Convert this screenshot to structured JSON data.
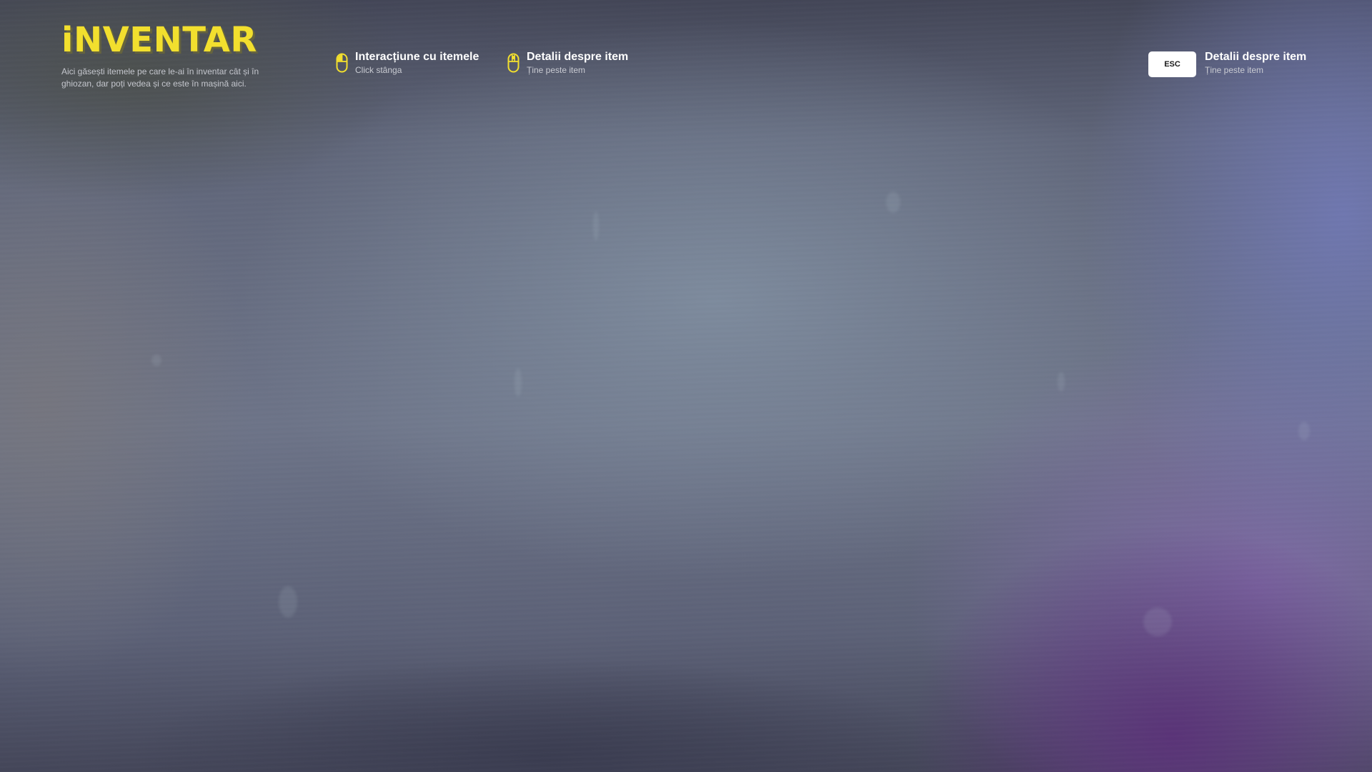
{
  "header": {
    "title": "iNVENTAR",
    "description": "Aici găsești itemele pe care le-ai în inventar cât și în ghiozan, dar poți vedea și ce este în mașină aici."
  },
  "hints": [
    {
      "title": "Interacțiune cu itemele",
      "subtitle": "Click stânga",
      "icon": "mouse-left-click-icon"
    },
    {
      "title": "Detalii despre item",
      "subtitle": "Ține peste item",
      "icon": "mouse-hover-icon"
    }
  ],
  "close_hint": {
    "key": "ESC",
    "title": "Detalii despre item",
    "subtitle": "Ține peste item"
  },
  "colors": {
    "accent": "#f2df2e",
    "text_primary": "#ffffff",
    "text_secondary": "#c9cbd2"
  }
}
